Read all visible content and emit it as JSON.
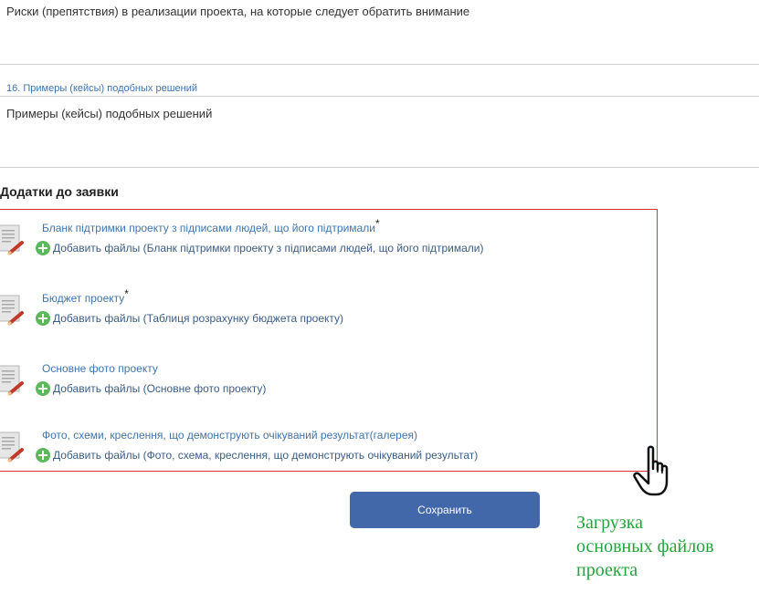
{
  "risks_field": {
    "placeholder": "Риски (препятствия) в реализации проекта, на которые следует обратить внимание"
  },
  "cases_field": {
    "label": "16. Примеры (кейсы) подобных решений",
    "placeholder": "Примеры (кейсы) подобных решений"
  },
  "attachments": {
    "section_title": "Додатки до заявки",
    "items": [
      {
        "title": "Бланк підтримки проекту з підписами людей, що його підтримали",
        "required_mark": "*",
        "add_label": "Добавить файлы (Бланк підтримки проекту з підписами людей, що його підтримали)"
      },
      {
        "title": "Бюджет проекту",
        "required_mark": "*",
        "add_label": "Добавить файлы (Таблиця розрахунку бюджета проекту)"
      },
      {
        "title": "Основне фото проекту",
        "required_mark": "",
        "add_label": "Добавить файлы (Основне фото проекту)"
      },
      {
        "title": "Фото, схеми, креслення, що демонструють очікуваний результат(галерея)",
        "required_mark": "",
        "add_label": "Добавить файлы (Фото, схема, креслення, що демонструють очікуваний результат)"
      }
    ]
  },
  "save_button": {
    "label": "Сохранить"
  },
  "annotation": {
    "lines": [
      "Загрузка",
      "основных файлов",
      "проекта"
    ],
    "color": "#22a63a"
  },
  "colors": {
    "link": "#3f74b0",
    "button": "#4268a9",
    "highlight_border": "#e03030",
    "add_icon": "#5cb85c"
  },
  "icons": {
    "document": "document-icon",
    "edit": "pencil-icon",
    "add": "plus-circle-icon",
    "cursor": "hand-pointer-icon"
  }
}
